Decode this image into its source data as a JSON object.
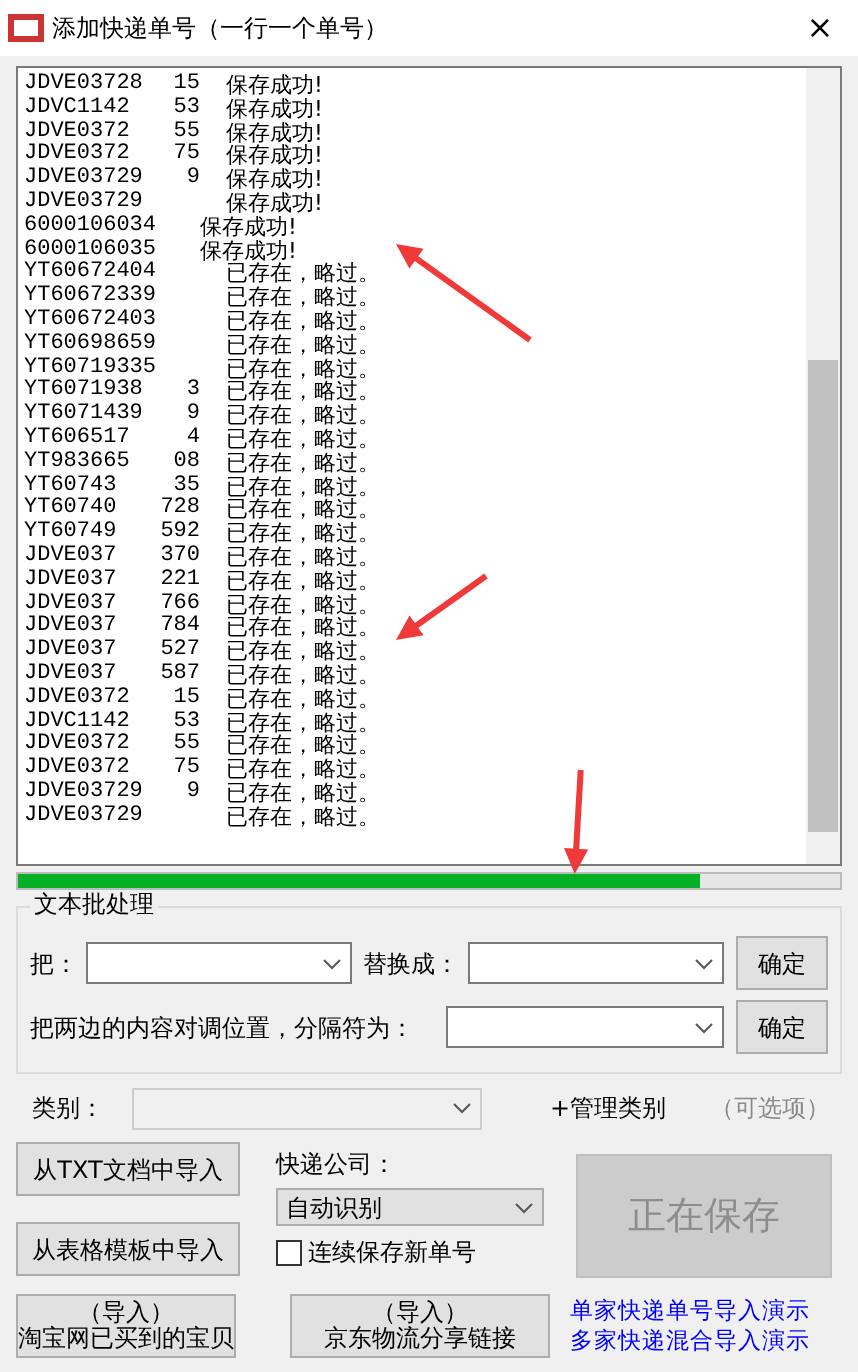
{
  "window": {
    "title": "添加快递单号（一行一个单号）",
    "close": "×"
  },
  "log": {
    "lines": [
      {
        "start": "JDVE03728",
        "end": "15",
        "message": "保存成功!"
      },
      {
        "start": "JDVC1142",
        "end": "53",
        "message": "保存成功!"
      },
      {
        "start": "JDVE0372",
        "end": "55",
        "message": "保存成功!"
      },
      {
        "start": "JDVE0372",
        "end": "75",
        "message": "保存成功!"
      },
      {
        "start": "JDVE03729",
        "end": "9",
        "message": "保存成功!"
      },
      {
        "start": "JDVE03729",
        "message": "保存成功!"
      },
      {
        "start": "6000106034",
        "message": "保存成功!",
        "kind": "short"
      },
      {
        "start": "6000106035",
        "message": "保存成功!",
        "kind": "short"
      },
      {
        "start": "YT60672404",
        "message": "已存在，略过。"
      },
      {
        "start": "YT60672339",
        "message": "已存在，略过。"
      },
      {
        "start": "YT60672403",
        "message": "已存在，略过。"
      },
      {
        "start": "YT60698659",
        "message": "已存在，略过。"
      },
      {
        "start": "YT60719335",
        "message": "已存在，略过。"
      },
      {
        "start": "YT6071938",
        "end": "3",
        "message": "已存在，略过。"
      },
      {
        "start": "YT6071439",
        "end": "9",
        "message": "已存在，略过。"
      },
      {
        "start": "YT606517",
        "end": "4",
        "message": "已存在，略过。"
      },
      {
        "start": "YT983665",
        "end": "08",
        "message": "已存在，略过。"
      },
      {
        "start": "YT60743",
        "end": "35",
        "message": "已存在，略过。"
      },
      {
        "start": "YT60740",
        "end": "728",
        "message": "已存在，略过。"
      },
      {
        "start": "YT60749",
        "end": "592",
        "message": "已存在，略过。"
      },
      {
        "start": "JDVE037",
        "end": "370",
        "message": "已存在，略过。"
      },
      {
        "start": "JDVE037",
        "end": "221",
        "message": "已存在，略过。"
      },
      {
        "start": "JDVE037",
        "end": "766",
        "message": "已存在，略过。"
      },
      {
        "start": "JDVE037",
        "end": "784",
        "message": "已存在，略过。"
      },
      {
        "start": "JDVE037",
        "end": "527",
        "message": "已存在，略过。"
      },
      {
        "start": "JDVE037",
        "end": "587",
        "message": "已存在，略过。"
      },
      {
        "start": "JDVE0372",
        "end": "15",
        "message": "已存在，略过。"
      },
      {
        "start": "JDVC1142",
        "end": "53",
        "message": "已存在，略过。"
      },
      {
        "start": "JDVE0372",
        "end": "55",
        "message": "已存在，略过。"
      },
      {
        "start": "JDVE0372",
        "end": "75",
        "message": "已存在，略过。"
      },
      {
        "start": "JDVE03729",
        "end": "9",
        "message": "已存在，略过。"
      },
      {
        "start": "JDVE03729",
        "message": "已存在，略过。"
      }
    ]
  },
  "progress": {
    "level": 0.83
  },
  "batch": {
    "title": "文本批处理",
    "replace_from_label": "把：",
    "replace_to_label": "替换成：",
    "replace_button": "确定",
    "swap_label": "把两边的内容对调位置，分隔符为：",
    "swap_button": "确定"
  },
  "category": {
    "label": "类别：",
    "manage_link": "+管理类别",
    "optional_note": "（可选项）"
  },
  "import_txt_button": "从TXT文档中导入",
  "import_template_button": "从表格模板中导入",
  "courier": {
    "label": "快递公司：",
    "value": "自动识别"
  },
  "continuous_save": {
    "label": "连续保存新单号",
    "checked": false
  },
  "save_button": {
    "label": "正在保存",
    "disabled": true
  },
  "taobao_button": {
    "line1": "（导入）",
    "line2": "淘宝网已买到的宝贝"
  },
  "jd_button": {
    "line1": "（导入）",
    "line2": "京东物流分享链接"
  },
  "demo_links": [
    "单家快递单号导入演示",
    "多家快递混合导入演示"
  ]
}
